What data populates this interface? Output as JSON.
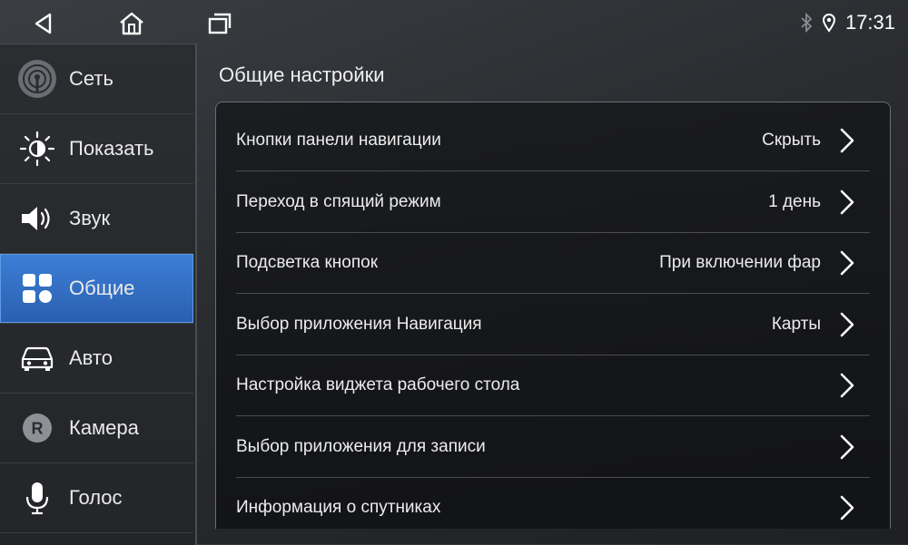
{
  "statusbar": {
    "time": "17:31",
    "icons": [
      "back-icon",
      "home-icon",
      "recents-icon",
      "bluetooth-icon",
      "location-icon"
    ]
  },
  "sidebar": {
    "items": [
      {
        "label": "Сеть",
        "icon": "network-icon"
      },
      {
        "label": "Показать",
        "icon": "brightness-icon"
      },
      {
        "label": "Звук",
        "icon": "speaker-icon"
      },
      {
        "label": "Общие",
        "icon": "general-grid-icon",
        "active": true
      },
      {
        "label": "Авто",
        "icon": "car-icon"
      },
      {
        "label": "Камера",
        "icon": "camera-r-icon"
      },
      {
        "label": "Голос",
        "icon": "microphone-icon"
      }
    ]
  },
  "main": {
    "title": "Общие настройки",
    "rows": [
      {
        "label": "Кнопки панели навигации",
        "value": "Скрыть"
      },
      {
        "label": "Переход в спящий режим",
        "value": "1 день"
      },
      {
        "label": "Подсветка кнопок",
        "value": "При включении фар"
      },
      {
        "label": "Выбор приложения Навигация",
        "value": "Карты"
      },
      {
        "label": "Настройка виджета рабочего стола",
        "value": ""
      },
      {
        "label": "Выбор приложения для записи",
        "value": ""
      },
      {
        "label": "Информация о спутниках",
        "value": ""
      }
    ]
  },
  "colors": {
    "accent": "#2f6fc4",
    "background": "#2a2c30",
    "text": "#ececec"
  }
}
